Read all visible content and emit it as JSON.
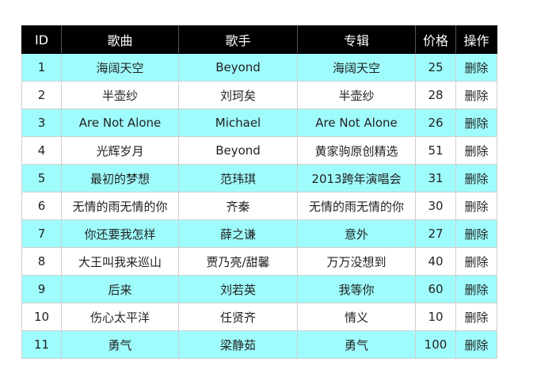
{
  "table": {
    "headers": [
      "ID",
      "歌曲",
      "歌手",
      "专辑",
      "价格",
      "操作"
    ],
    "rows": [
      {
        "id": "1",
        "song": "海阔天空",
        "singer": "Beyond",
        "album": "海阔天空",
        "price": "25",
        "action": "删除"
      },
      {
        "id": "2",
        "song": "半壶纱",
        "singer": "刘珂矣",
        "album": "半壶纱",
        "price": "28",
        "action": "删除"
      },
      {
        "id": "3",
        "song": "Are Not Alone",
        "singer": "Michael",
        "album": "Are Not Alone",
        "price": "26",
        "action": "删除"
      },
      {
        "id": "4",
        "song": "光辉岁月",
        "singer": "Beyond",
        "album": "黄家驹原创精选",
        "price": "51",
        "action": "删除"
      },
      {
        "id": "5",
        "song": "最初的梦想",
        "singer": "范玮琪",
        "album": "2013跨年演唱会",
        "price": "31",
        "action": "删除"
      },
      {
        "id": "6",
        "song": "无情的雨无情的你",
        "singer": "齐秦",
        "album": "无情的雨无情的你",
        "price": "30",
        "action": "删除"
      },
      {
        "id": "7",
        "song": "你还要我怎样",
        "singer": "薛之谦",
        "album": "意外",
        "price": "27",
        "action": "删除"
      },
      {
        "id": "8",
        "song": "大王叫我来巡山",
        "singer": "贾乃亮/甜馨",
        "album": "万万没想到",
        "price": "40",
        "action": "删除"
      },
      {
        "id": "9",
        "song": "后来",
        "singer": "刘若英",
        "album": "我等你",
        "price": "60",
        "action": "删除"
      },
      {
        "id": "10",
        "song": "伤心太平洋",
        "singer": "任贤齐",
        "album": "情义",
        "price": "10",
        "action": "删除"
      },
      {
        "id": "11",
        "song": "勇气",
        "singer": "梁静茹",
        "album": "勇气",
        "price": "100",
        "action": "删除"
      }
    ]
  },
  "colors": {
    "header_bg": "#000000",
    "header_text": "#ffffff",
    "odd_row_bg": "#9ffcfc",
    "even_row_bg": "#ffffff"
  }
}
